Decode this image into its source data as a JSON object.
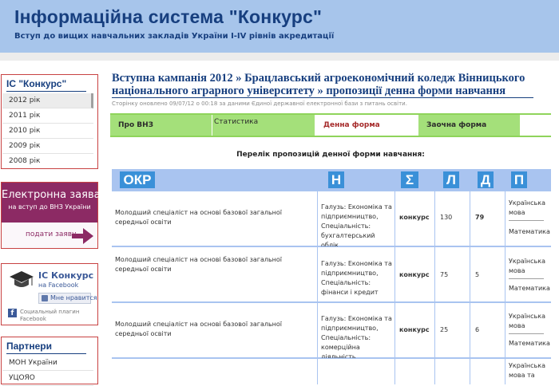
{
  "header": {
    "title": "Інформаційна система \"Конкурс\"",
    "subtitle": "Вступ до вищих навчальних закладів України I-IV рівнів акредитації"
  },
  "sidebar": {
    "ic_title": "ІС \"Конкурс\"",
    "years": [
      "2012 рік",
      "2011 рік",
      "2010 рік",
      "2009 рік",
      "2008 рік"
    ],
    "active_year_index": 0,
    "application": {
      "title": "Електронна заява",
      "subtitle": "на вступ до ВНЗ України",
      "link": "подати заяву"
    },
    "facebook": {
      "name": "ІС Конкурс",
      "sub": "на Facebook",
      "like": "Мне нравится",
      "plugin": "Социальный плагин Facebook"
    },
    "partners": {
      "title": "Партнери",
      "items": [
        "МОН України",
        "УЦОЯО"
      ]
    }
  },
  "main": {
    "campaign_title": "Вступна кампанія 2012 » Брацлавський агроекономічний коледж Вінницького національного аграрного університету » пропозиції денна форми навчання",
    "updated": "Сторінку оновлено 09/07/12 о 00:18 за даними Єдиної державної електронної бази з питань освіти.",
    "tabs": [
      "Про ВНЗ",
      "Статистика",
      "Денна форма",
      "Заочна форма"
    ],
    "active_tab_index": 2,
    "list_title": "Перелік пропозицій денної форми навчання:",
    "columns": [
      "ОКР",
      "Н",
      "Σ",
      "Л",
      "Д",
      "П"
    ],
    "rows": [
      {
        "okr": "Молодший спеціаліст на основі базової загальної середньої освіти",
        "field": "Галузь: Економіка та підприємництво, Спеціальність: бухгалтерський облік",
        "type": "конкурс",
        "l": "130",
        "d": "79",
        "subjects": [
          "Українська мова",
          "Математика"
        ]
      },
      {
        "okr": "Молодший спеціаліст на основі базової загальної середньої освіти",
        "field": "Галузь: Економіка та підприємництво, Спеціальність: фінанси і кредит",
        "type": "конкурс",
        "l": "75",
        "d": "5",
        "subjects": [
          "Українська мова",
          "Математика"
        ]
      },
      {
        "okr": "Молодший спеціаліст на основі базової загальної середньої освіти",
        "field": "Галузь: Економіка та підприємництво, Спеціальність: комерційна діяльність",
        "type": "конкурс",
        "l": "25",
        "d": "6",
        "subjects": [
          "Українська мова",
          "Математика"
        ]
      },
      {
        "okr": "",
        "field": "",
        "type": "",
        "l": "",
        "d": "",
        "subjects": [
          "Українська мова та"
        ]
      }
    ]
  }
}
